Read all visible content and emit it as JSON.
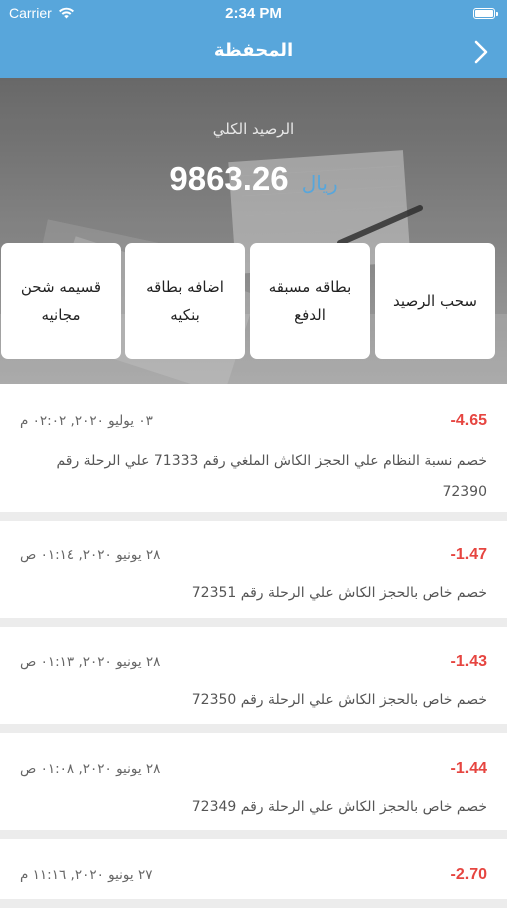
{
  "status": {
    "carrier": "Carrier",
    "time": "2:34 PM"
  },
  "nav": {
    "title": "المحفظة",
    "back_icon": "chevron-right-icon"
  },
  "wallet": {
    "balance_label": "الرصيد الكلي",
    "balance": "9863.26",
    "currency": "ريال"
  },
  "actions": [
    {
      "label": "سحب الرصيد"
    },
    {
      "label": "بطاقه مسبقه الدفع"
    },
    {
      "label": "اضافه بطاقه بنكيه"
    },
    {
      "label": "قسيمه شحن مجانيه"
    }
  ],
  "transactions": [
    {
      "amount": "-4.65",
      "date": "٠٣ يوليو ٢٠٢٠, ٠٢:٠٢ م",
      "description": "خصم نسبة النظام علي الحجز الكاش الملغي رقم 71333 علي الرحلة رقم 72390"
    },
    {
      "amount": "-1.47",
      "date": "٢٨ يونيو ٢٠٢٠, ٠١:١٤ ص",
      "description": "خصم خاص بالحجز الكاش علي الرحلة رقم 72351"
    },
    {
      "amount": "-1.43",
      "date": "٢٨ يونيو ٢٠٢٠, ٠١:١٣ ص",
      "description": "خصم خاص بالحجز الكاش علي الرحلة رقم 72350"
    },
    {
      "amount": "-1.44",
      "date": "٢٨ يونيو ٢٠٢٠, ٠١:٠٨ ص",
      "description": "خصم خاص بالحجز الكاش علي الرحلة رقم 72349"
    },
    {
      "amount": "-2.70",
      "date": "٢٧ يونيو ٢٠٢٠, ١١:١٦ م",
      "description": ""
    }
  ],
  "colors": {
    "accent": "#58a6db",
    "negative": "#e64540"
  }
}
